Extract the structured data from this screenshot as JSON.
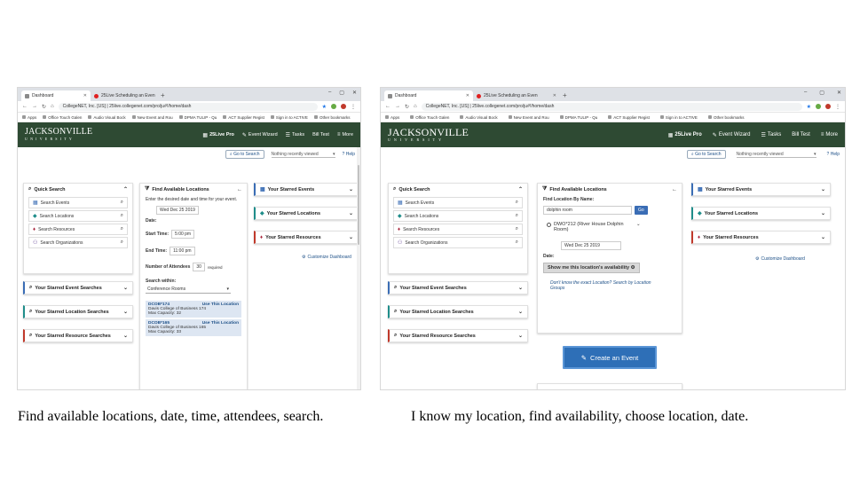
{
  "left": {
    "browser": {
      "tabs": [
        {
          "label": "Dashboard",
          "active": true
        },
        {
          "label": "25Live Scheduling an Even",
          "active": false
        }
      ],
      "url": "CollegeNET, Inc. [US]  |  25live.collegenet.com/pro/ju#!/home/dash",
      "bookmarks": [
        "Apps",
        "Office Touch Galen",
        "Audio Visual Bock",
        "New Event and Rou",
        "DPMA TULIP - Qu",
        "ACT Supplier Regist",
        "Sign in to ACTIVE",
        "Other bookmarks"
      ]
    },
    "header": {
      "logo_line1": "JACKSONVILLE",
      "logo_line2": "UNIVERSITY",
      "menu": [
        "25Live Pro",
        "Event Wizard",
        "Tasks",
        "Bill Test",
        "More"
      ]
    },
    "search_row": {
      "go_to_search": "Go to Search",
      "recent": "Nothing recently viewed",
      "help": "Help"
    },
    "quick_search": {
      "title": "Quick Search",
      "items": [
        {
          "icon": "calendar-icon",
          "label": "Search Events"
        },
        {
          "icon": "location-cube-icon",
          "label": "Search Locations"
        },
        {
          "icon": "resource-icon",
          "label": "Search Resources"
        },
        {
          "icon": "organization-icon",
          "label": "Search Organizations"
        }
      ]
    },
    "starred_searches": [
      {
        "label": "Your Starred Event Searches"
      },
      {
        "label": "Your Starred Location Searches"
      },
      {
        "label": "Your Starred Resource Searches"
      }
    ],
    "find_locations": {
      "title": "Find Available Locations",
      "intro": "Enter the desired date and time for your event.",
      "date_value": "Wed Dec 25 2019",
      "date_label": "Date:",
      "start_label": "Start Time:",
      "start_value": "5:00 pm",
      "end_label": "End Time:",
      "end_value": "11:00 pm",
      "attendees_label": "Number of Attendees",
      "attendees_value": "30",
      "required": "required",
      "search_within_label": "Search within:",
      "search_within_value": "Conference Rooms",
      "results": [
        {
          "name": "DCOB*174",
          "use": "Use This Location",
          "line1": "Davis College of Business 174",
          "line2": "Max Capacity: 32"
        },
        {
          "name": "DCOB*165",
          "use": "Use This Location",
          "line1": "Davis College of Business 165",
          "line2": "Max Capacity: 33"
        }
      ]
    },
    "starred": {
      "events": "Your Starred Events",
      "locations": "Your Starred Locations",
      "resources": "Your Starred Resources"
    },
    "customize": "Customize Dashboard"
  },
  "right": {
    "browser": {
      "tabs": [
        {
          "label": "Dashboard",
          "active": true
        },
        {
          "label": "25Live Scheduling an Even",
          "active": false
        }
      ],
      "url": "CollegeNET, Inc. [US]  |  25live.collegenet.com/pro/ju#!/home/dash",
      "bookmarks": [
        "Apps",
        "Office Touch Galen",
        "Audio Visual Bock",
        "New Event and Rou",
        "DPMA TULIP - Qu",
        "ACT Supplier Regist",
        "Sign in to ACTIVE",
        "Other bookmarks"
      ]
    },
    "header": {
      "logo_line1": "JACKSONVILLE",
      "logo_line2": "UNIVERSITY",
      "menu": [
        "25Live Pro",
        "Event Wizard",
        "Tasks",
        "Bill Test",
        "More"
      ]
    },
    "search_row": {
      "go_to_search": "Go to Search",
      "recent": "Nothing recently viewed",
      "help": "Help"
    },
    "quick_search": {
      "title": "Quick Search",
      "items": [
        {
          "icon": "calendar-icon",
          "label": "Search Events"
        },
        {
          "icon": "location-cube-icon",
          "label": "Search Locations"
        },
        {
          "icon": "resource-icon",
          "label": "Search Resources"
        },
        {
          "icon": "organization-icon",
          "label": "Search Organizations"
        }
      ]
    },
    "starred_searches": [
      {
        "label": "Your Starred Event Searches"
      },
      {
        "label": "Your Starred Location Searches"
      },
      {
        "label": "Your Starred Resource Searches"
      }
    ],
    "find_locations": {
      "title": "Find Available Locations",
      "by_name_label": "Find Location By Name:",
      "by_name_value": "dolphin room",
      "go": "Go",
      "result": "DWO*212 (River House Dolphin Room)",
      "date_value": "Wed Dec 25 2019",
      "date_label": "Date:",
      "show_button": "Show me this location's availability",
      "unknown_link": "Don't know the exact Location? Search by Location Groups"
    },
    "starred": {
      "events": "Your Starred Events",
      "locations": "Your Starred Locations",
      "resources": "Your Starred Resources"
    },
    "customize": "Customize Dashboard",
    "create_event": "Create an Event"
  },
  "captions": {
    "left": "Find available locations, date, time, attendees, search.",
    "right": "I know my location, find availability, choose location, date."
  }
}
